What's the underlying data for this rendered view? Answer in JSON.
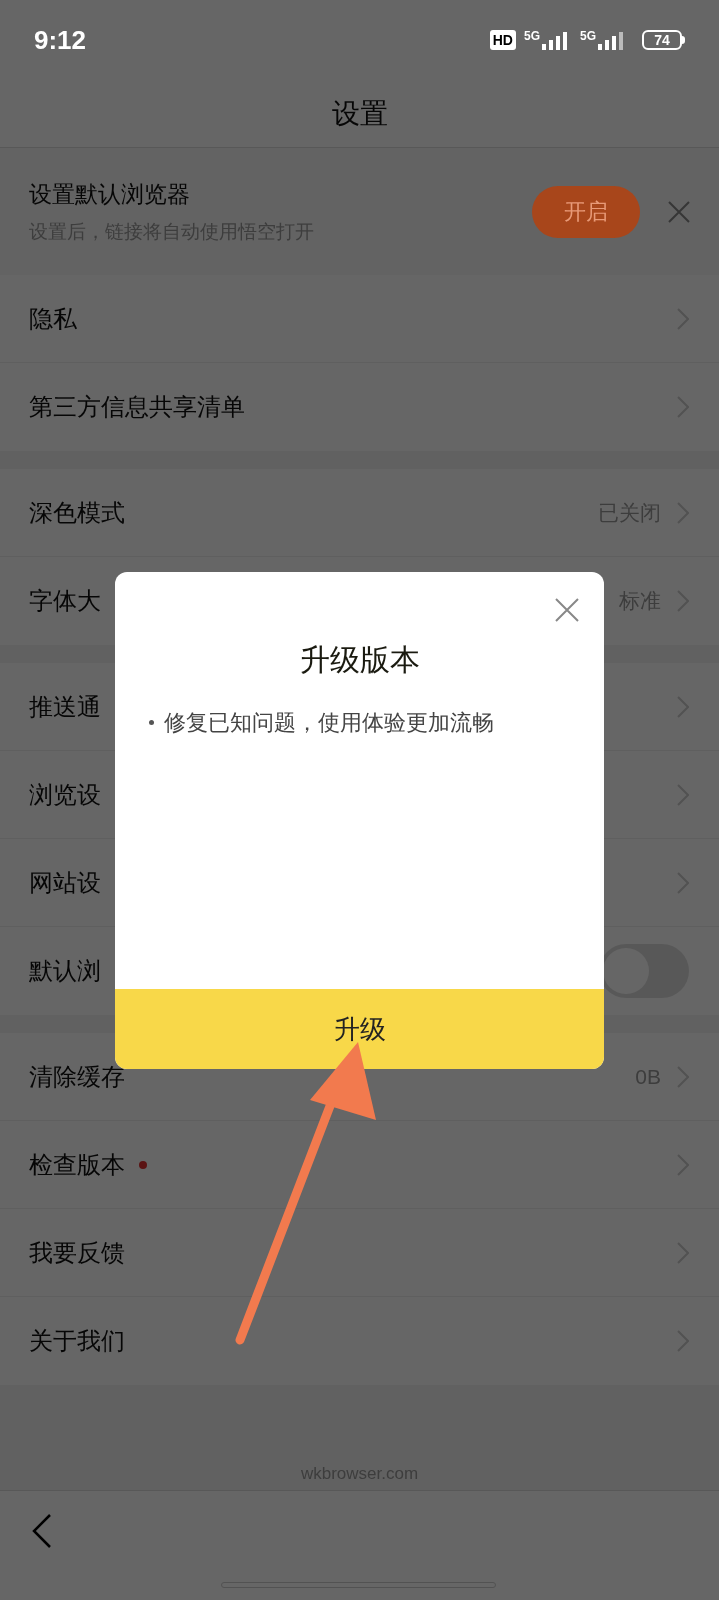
{
  "status_bar": {
    "time": "9:12",
    "hd": "HD",
    "network_1": "5G",
    "network_2": "5G",
    "battery": "74"
  },
  "header": {
    "title": "设置"
  },
  "banner": {
    "title": "设置默认浏览器",
    "subtitle": "设置后，链接将自动使用悟空打开",
    "button": "开启"
  },
  "groups": [
    [
      {
        "kind": "link",
        "label": "隐私"
      },
      {
        "kind": "link",
        "label": "第三方信息共享清单"
      }
    ],
    [
      {
        "kind": "link",
        "label": "深色模式",
        "value": "已关闭"
      },
      {
        "kind": "link",
        "label": "字体大",
        "value": "标准"
      }
    ],
    [
      {
        "kind": "link",
        "label": "推送通"
      },
      {
        "kind": "link",
        "label": "浏览设"
      },
      {
        "kind": "link",
        "label": "网站设"
      },
      {
        "kind": "toggle",
        "label": "默认浏",
        "on": false
      }
    ],
    [
      {
        "kind": "link",
        "label": "清除缓存",
        "value": "0B"
      },
      {
        "kind": "link",
        "label": "检查版本",
        "new_dot": true
      },
      {
        "kind": "link",
        "label": "我要反馈"
      },
      {
        "kind": "link",
        "label": "关于我们"
      }
    ]
  ],
  "footer": "wkbrowser.com",
  "dialog": {
    "title": "升级版本",
    "notes": [
      "修复已知问题，使用体验更加流畅"
    ],
    "button": "升级"
  }
}
